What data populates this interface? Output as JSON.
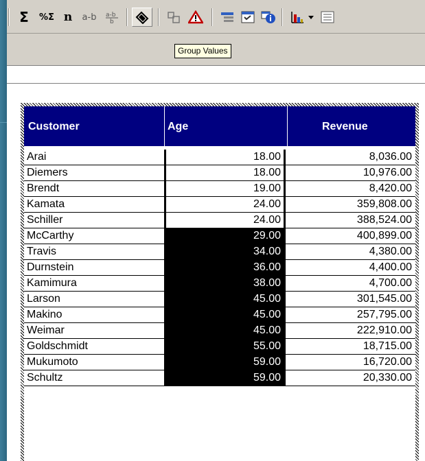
{
  "toolbar": {
    "sum_label": "Σ",
    "percent_sum_label": "%Σ",
    "count_label": "n",
    "ab_label": "a-b",
    "ab_fraction_label": "a-b",
    "group_values_tooltip": "Group Values"
  },
  "table": {
    "headers": {
      "customer": "Customer",
      "age": "Age",
      "revenue": "Revenue"
    },
    "rows": [
      {
        "customer": "Arai",
        "age": "18.00",
        "revenue": "8,036.00",
        "grouped": false
      },
      {
        "customer": "Diemers",
        "age": "18.00",
        "revenue": "10,976.00",
        "grouped": false
      },
      {
        "customer": "Brendt",
        "age": "19.00",
        "revenue": "8,420.00",
        "grouped": false
      },
      {
        "customer": "Kamata",
        "age": "24.00",
        "revenue": "359,808.00",
        "grouped": false
      },
      {
        "customer": "Schiller",
        "age": "24.00",
        "revenue": "388,524.00",
        "grouped": false
      },
      {
        "customer": "McCarthy",
        "age": "29.00",
        "revenue": "400,899.00",
        "grouped": true
      },
      {
        "customer": "Travis",
        "age": "34.00",
        "revenue": "4,380.00",
        "grouped": true
      },
      {
        "customer": "Durnstein",
        "age": "36.00",
        "revenue": "4,400.00",
        "grouped": true
      },
      {
        "customer": "Kamimura",
        "age": "38.00",
        "revenue": "4,700.00",
        "grouped": true
      },
      {
        "customer": "Larson",
        "age": "45.00",
        "revenue": "301,545.00",
        "grouped": true
      },
      {
        "customer": "Makino",
        "age": "45.00",
        "revenue": "257,795.00",
        "grouped": true
      },
      {
        "customer": "Weimar",
        "age": "45.00",
        "revenue": "222,910.00",
        "grouped": true
      },
      {
        "customer": "Goldschmidt",
        "age": "55.00",
        "revenue": "18,715.00",
        "grouped": true
      },
      {
        "customer": "Mukumoto",
        "age": "59.00",
        "revenue": "16,720.00",
        "grouped": true
      },
      {
        "customer": "Schultz",
        "age": "59.00",
        "revenue": "20,330.00",
        "grouped": true
      }
    ]
  },
  "colors": {
    "header_bg": "#000080",
    "toolbar_bg": "#d4d0c8",
    "desktop_bg": "#2e6a86"
  }
}
